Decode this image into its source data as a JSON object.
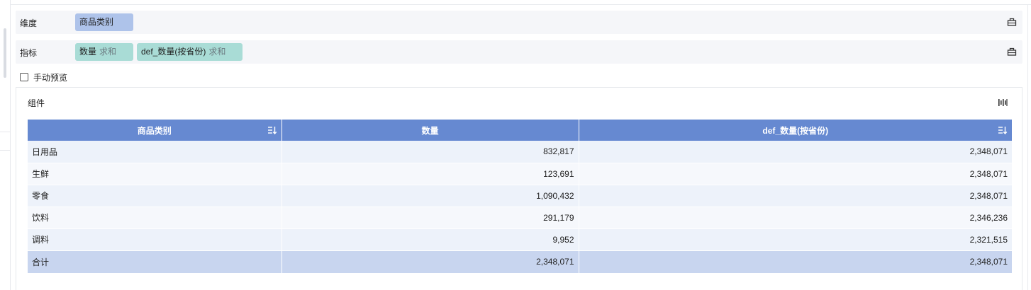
{
  "dimension_row": {
    "label": "维度",
    "chips": [
      {
        "text": "商品类别"
      }
    ]
  },
  "measure_row": {
    "label": "指标",
    "chips": [
      {
        "text": "数量",
        "agg": "求和"
      },
      {
        "text": "def_数量(按省份)",
        "agg": "求和"
      }
    ]
  },
  "manual_preview": {
    "label": "手动预览",
    "checked": false
  },
  "panel": {
    "title": "组件",
    "table": {
      "columns": [
        "商品类别",
        "数量",
        "def_数量(按省份)"
      ],
      "rows": [
        [
          "日用品",
          "832,817",
          "2,348,071"
        ],
        [
          "生鲜",
          "123,691",
          "2,348,071"
        ],
        [
          "零食",
          "1,090,432",
          "2,348,071"
        ],
        [
          "饮料",
          "291,179",
          "2,346,236"
        ],
        [
          "调料",
          "9,952",
          "2,321,515"
        ]
      ],
      "total": [
        "合计",
        "2,348,071",
        "2,348,071"
      ]
    }
  },
  "colors": {
    "header_bg": "#6689d1",
    "dimension_chip": "#aec3ea",
    "measure_chip": "#a9dcd6",
    "total_row": "#c8d5ef"
  },
  "icons": {
    "row_settings": "bar-settings-icon",
    "panel_settings": "column-config-icon",
    "sort": "sort-descending-icon"
  }
}
